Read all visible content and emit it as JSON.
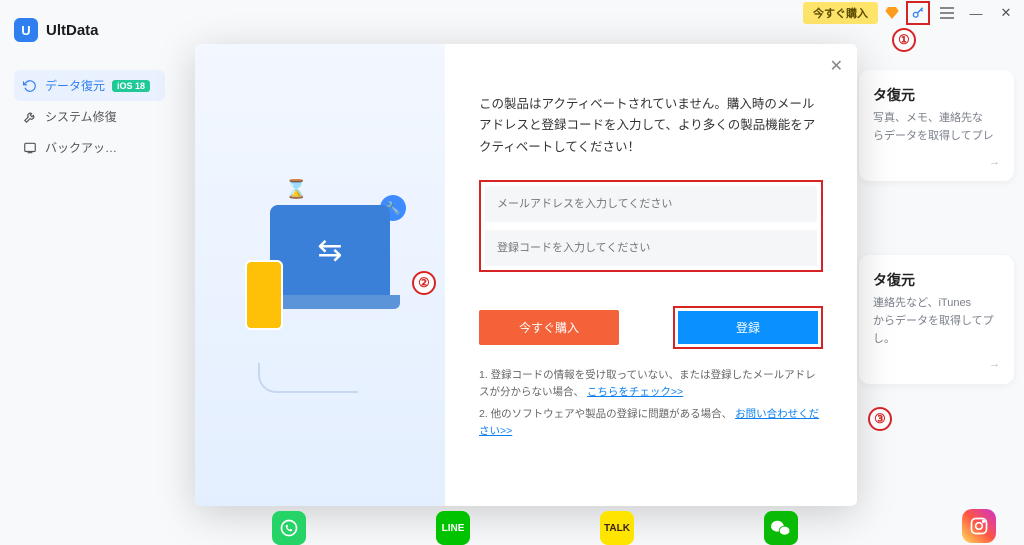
{
  "titlebar": {
    "buy_label": "今すぐ購入"
  },
  "brand": {
    "name": "UltData",
    "logo_letter": "U"
  },
  "sidebar": {
    "items": [
      {
        "label": "データ復元",
        "badge": "iOS 18"
      },
      {
        "label": "システム修復"
      },
      {
        "label": "バックアッ…"
      }
    ]
  },
  "cards": [
    {
      "title": "タ復元",
      "desc": "写真、メモ、連絡先な\nらデータを取得してプレ"
    },
    {
      "title": "タ復元",
      "desc": "連絡先など、iTunes\nからデータを取得してプ\nし。"
    }
  ],
  "modal": {
    "message": "この製品はアクティベートされていません。購入時のメールアドレスと登録コードを入力して、より多くの製品機能をアクティベートしてください！",
    "email_placeholder": "メールアドレスを入力してください",
    "code_placeholder": "登録コードを入力してください",
    "buy_label": "今すぐ購入",
    "register_label": "登録",
    "note1_prefix": "1. 登録コードの情報を受け取っていない、または登録したメールアドレスが分からない場合、",
    "note1_link": "こちらをチェック>>",
    "note2_prefix": "2. 他のソフトウェアや製品の登録に問題がある場合、",
    "note2_link": "お問い合わせください>>"
  },
  "annotations": {
    "one": "①",
    "two": "②",
    "three": "③"
  },
  "bottom_icons": {
    "whatsapp": "",
    "line": "LINE",
    "kakao": "TALK",
    "wechat": "",
    "insta": ""
  }
}
